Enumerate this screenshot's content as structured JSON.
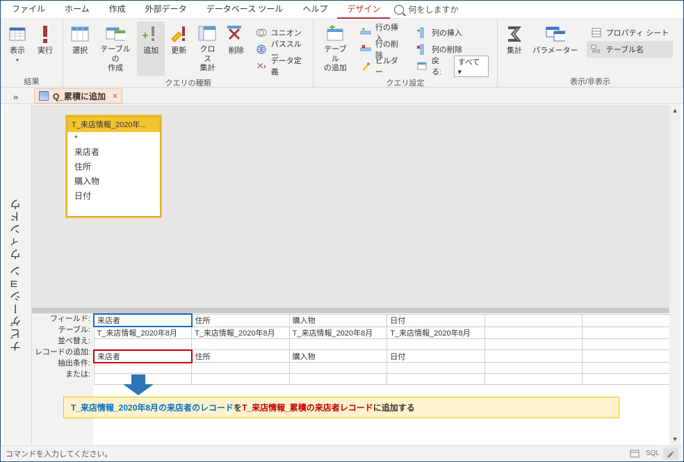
{
  "menu": {
    "items": [
      "ファイル",
      "ホーム",
      "作成",
      "外部データ",
      "データベース ツール",
      "ヘルプ",
      "デザイン"
    ],
    "active_index": 6,
    "search_placeholder": "何をしますか"
  },
  "ribbon": {
    "groups": [
      {
        "label": "結果",
        "buttons": [
          {
            "caption": "表示",
            "arrow": true
          },
          {
            "caption": "実行"
          }
        ]
      },
      {
        "label": "クエリの種類",
        "buttons": [
          {
            "caption": "選択"
          },
          {
            "caption": "テーブルの\n作成"
          },
          {
            "caption": "追加",
            "active": true
          },
          {
            "caption": "更新"
          },
          {
            "caption": "クロス\n集計"
          },
          {
            "caption": "削除"
          }
        ],
        "extras": [
          {
            "caption": "ユニオン"
          },
          {
            "caption": "パススルー"
          },
          {
            "caption": "データ定義"
          }
        ]
      },
      {
        "label": "クエリ設定",
        "buttons": [
          {
            "caption": "テーブル\nの追加"
          }
        ],
        "rows": [
          {
            "caption": "行の挿入"
          },
          {
            "caption": "行の削除"
          },
          {
            "caption": "ビルダー"
          }
        ],
        "cols": [
          {
            "caption": "列の挿入"
          },
          {
            "caption": "列の削除"
          },
          {
            "caption": "戻る:",
            "value": "すべて"
          }
        ]
      },
      {
        "label": "表示/非表示",
        "buttons": [
          {
            "caption": "集計"
          },
          {
            "caption": "パラメーター"
          }
        ],
        "right": [
          {
            "caption": "プロパティ シート"
          },
          {
            "caption": "テーブル名"
          }
        ]
      }
    ]
  },
  "tab": {
    "title": "Q_累積に追加",
    "close": "×"
  },
  "nav_panel": "ナビゲーション ウィンドウ",
  "table_source": {
    "title": "T_来店情報_2020年...",
    "fields": [
      "*",
      "来店者",
      "住所",
      "購入物",
      "日付"
    ]
  },
  "grid": {
    "row_labels": [
      "フィールド:",
      "テーブル:",
      "並べ替え:",
      "レコードの追加:",
      "抽出条件:",
      "または:"
    ],
    "cols": [
      {
        "field": "来店者",
        "table": "T_来店情報_2020年8月",
        "append": "来店者",
        "field_sel": true,
        "append_sel": true
      },
      {
        "field": "住所",
        "table": "T_来店情報_2020年8月",
        "append": "住所"
      },
      {
        "field": "購入物",
        "table": "T_来店情報_2020年8月",
        "append": "購入物"
      },
      {
        "field": "日付",
        "table": "T_来店情報_2020年8月",
        "append": "日付"
      },
      {
        "field": "",
        "table": "",
        "append": ""
      },
      {
        "field": "",
        "table": "",
        "append": ""
      }
    ]
  },
  "annotation": {
    "part1": "T_来店情報_2020年8月の来店者のレコード",
    "part2": "を",
    "part3": "T_来店情報_累積の来店者レコード",
    "part4": "に追加する"
  },
  "status": {
    "text": "コマンドを入力してください。",
    "sql": "SQL"
  }
}
